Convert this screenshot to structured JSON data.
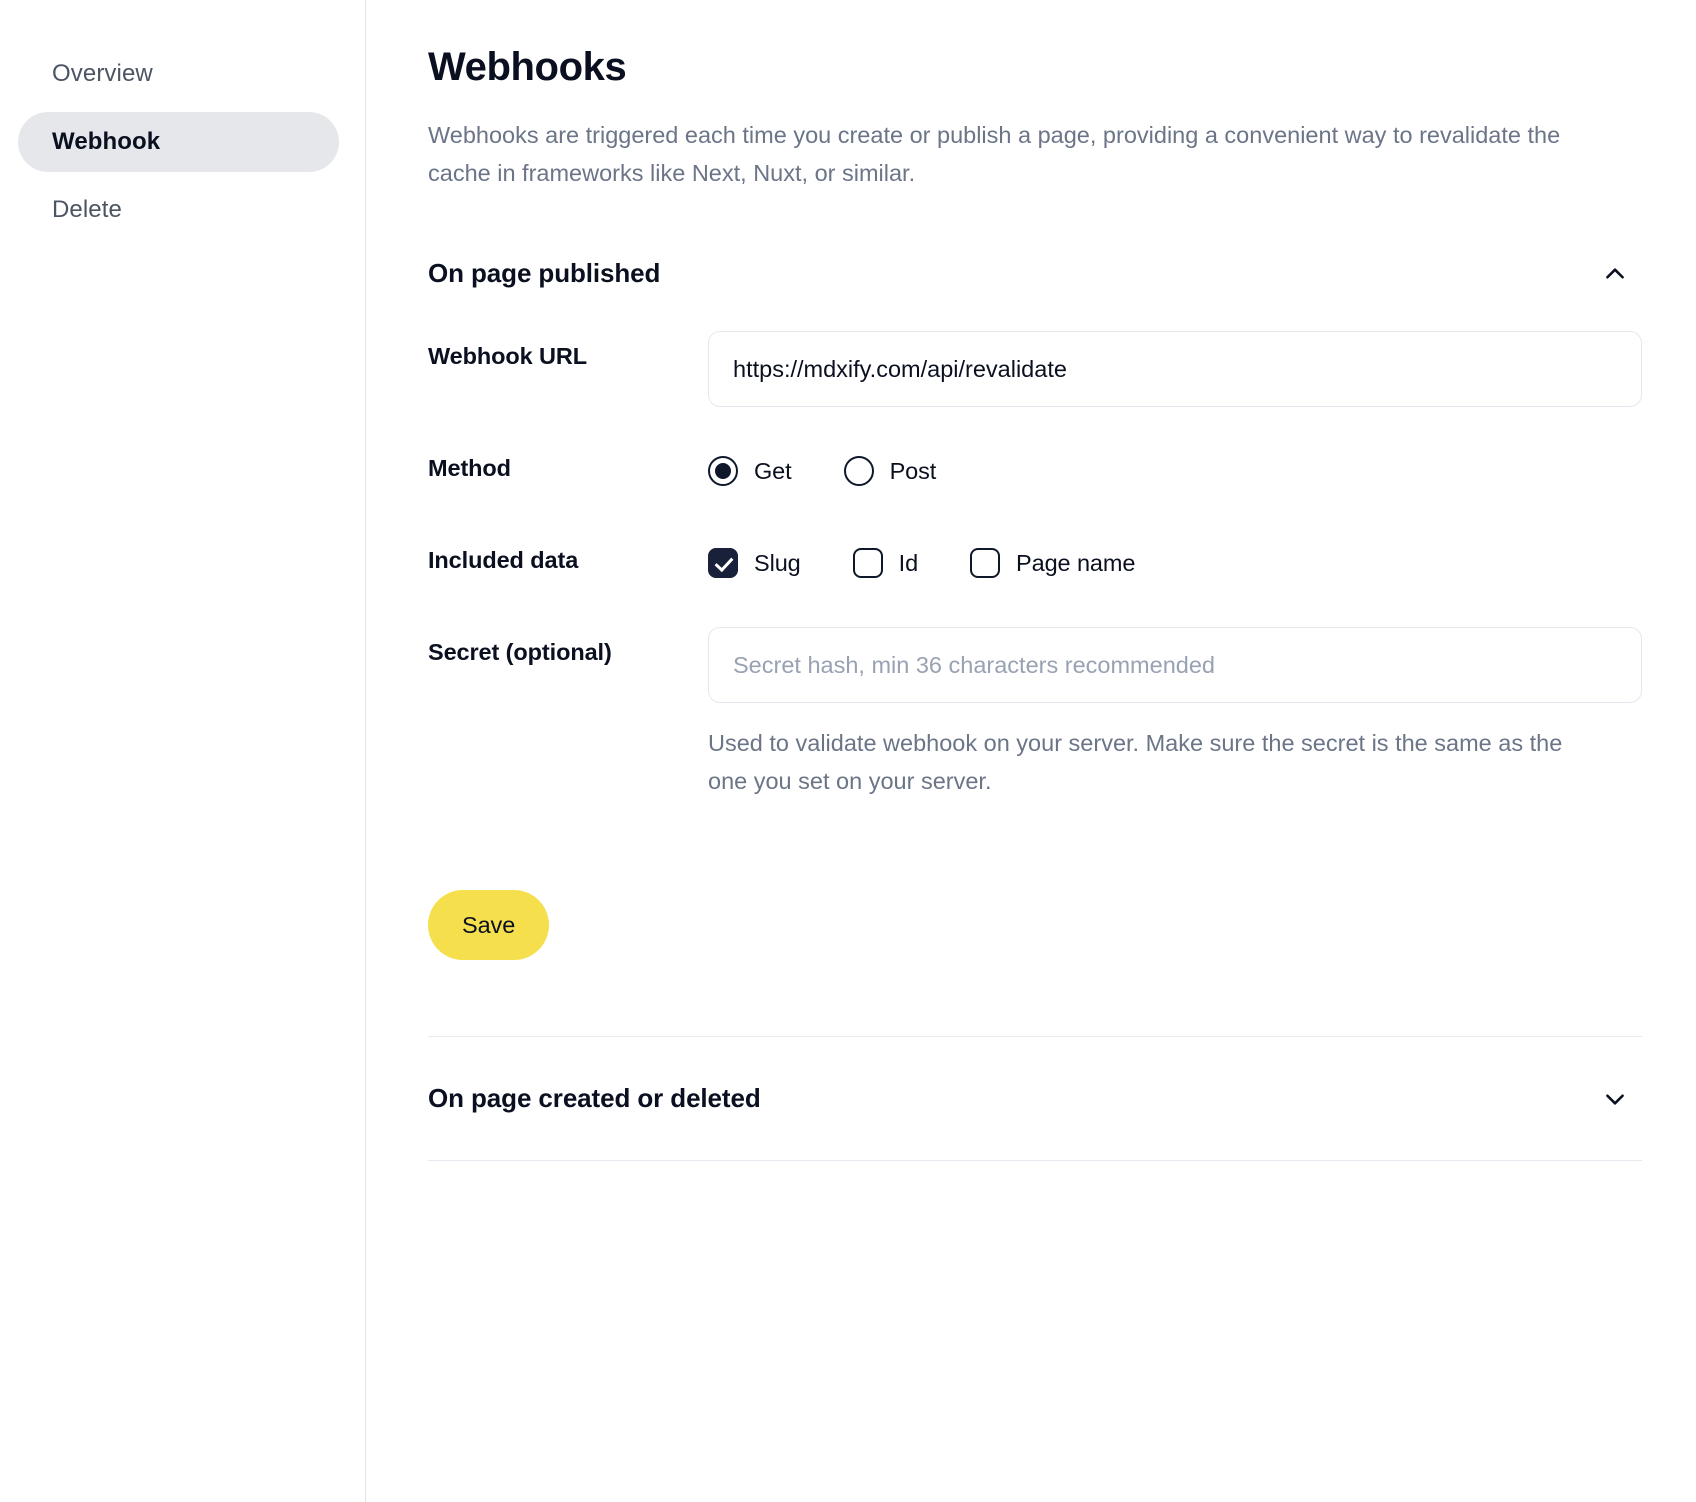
{
  "sidebar": {
    "items": [
      {
        "label": "Overview",
        "active": false
      },
      {
        "label": "Webhook",
        "active": true
      },
      {
        "label": "Delete",
        "active": false
      }
    ]
  },
  "header": {
    "title": "Webhooks",
    "description": "Webhooks are triggered each time you create or publish a page, providing a convenient way to revalidate the cache in frameworks like Next, Nuxt, or similar."
  },
  "published_section": {
    "title": "On page published",
    "expanded": true,
    "chevron_icon": "chevron-up-icon",
    "url_row": {
      "label": "Webhook URL",
      "value": "https://mdxify.com/api/revalidate",
      "placeholder": ""
    },
    "method_row": {
      "label": "Method",
      "options": [
        {
          "label": "Get",
          "selected": true
        },
        {
          "label": "Post",
          "selected": false
        }
      ]
    },
    "included_data_row": {
      "label": "Included data",
      "options": [
        {
          "label": "Slug",
          "checked": true
        },
        {
          "label": "Id",
          "checked": false
        },
        {
          "label": "Page name",
          "checked": false
        }
      ]
    },
    "secret_row": {
      "label": "Secret (optional)",
      "value": "",
      "placeholder": "Secret hash, min 36 characters recommended",
      "help": "Used to validate webhook on your server. Make sure the secret is the same as the one you set on your server."
    },
    "save_label": "Save"
  },
  "created_deleted_section": {
    "title": "On page created or deleted",
    "expanded": false,
    "chevron_icon": "chevron-down-icon"
  },
  "colors": {
    "accent_yellow": "#f5df4d",
    "active_nav_bg": "#e5e7eb",
    "muted_text": "#6b7587",
    "control_dark": "#18203a"
  }
}
